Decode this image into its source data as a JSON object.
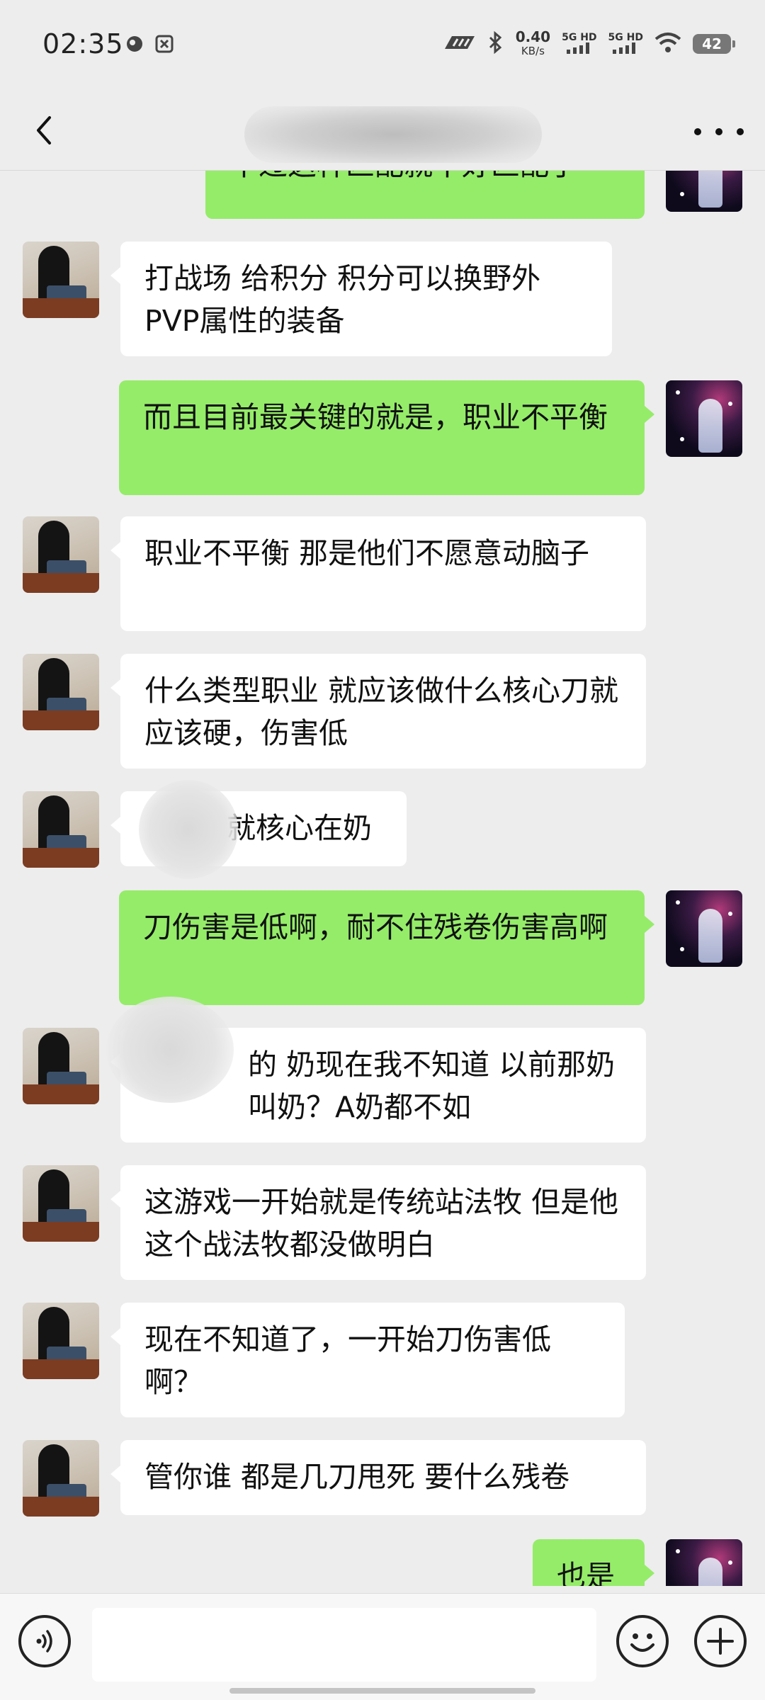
{
  "status_bar": {
    "time": "02:35",
    "net_speed_value": "0.40",
    "net_speed_unit": "KB/s",
    "sim1_label": "5G HD",
    "sim2_label": "5G HD",
    "battery": "42"
  },
  "header": {
    "title": "",
    "back_icon": "chevron-left-icon",
    "more_icon": "more-horizontal-icon"
  },
  "messages": [
    {
      "side": "right",
      "text": "不过这种匹配就不好匹配了"
    },
    {
      "side": "left",
      "text": "打战场 给积分 积分可以换野外PVP属性的装备"
    },
    {
      "side": "right",
      "text": "而且目前最关键的就是，职业不平衡"
    },
    {
      "side": "left",
      "text": "职业不平衡 那是他们不愿意动脑子"
    },
    {
      "side": "left",
      "text": "什么类型职业 就应该做什么核心刀就应该硬，伤害低"
    },
    {
      "side": "left",
      "text": "就核心在奶"
    },
    {
      "side": "right",
      "text": "刀伤害是低啊，耐不住残卷伤害高啊"
    },
    {
      "side": "left",
      "text": "的 奶现在我不知道 以前那奶叫奶？A奶都不如"
    },
    {
      "side": "left",
      "text": "这游戏一开始就是传统站法牧 但是他这个战法牧都没做明白"
    },
    {
      "side": "left",
      "text": "现在不知道了，一开始刀伤害低啊？"
    },
    {
      "side": "left",
      "text": "管你谁 都是几刀甩死 要什么残卷"
    },
    {
      "side": "right",
      "text": "也是"
    }
  ],
  "input_bar": {
    "placeholder": "",
    "voice_icon": "voice-icon",
    "emoji_icon": "emoji-icon",
    "plus_icon": "plus-icon"
  },
  "colors": {
    "background": "#ededed",
    "sent_bubble": "#95ec69",
    "received_bubble": "#ffffff"
  }
}
